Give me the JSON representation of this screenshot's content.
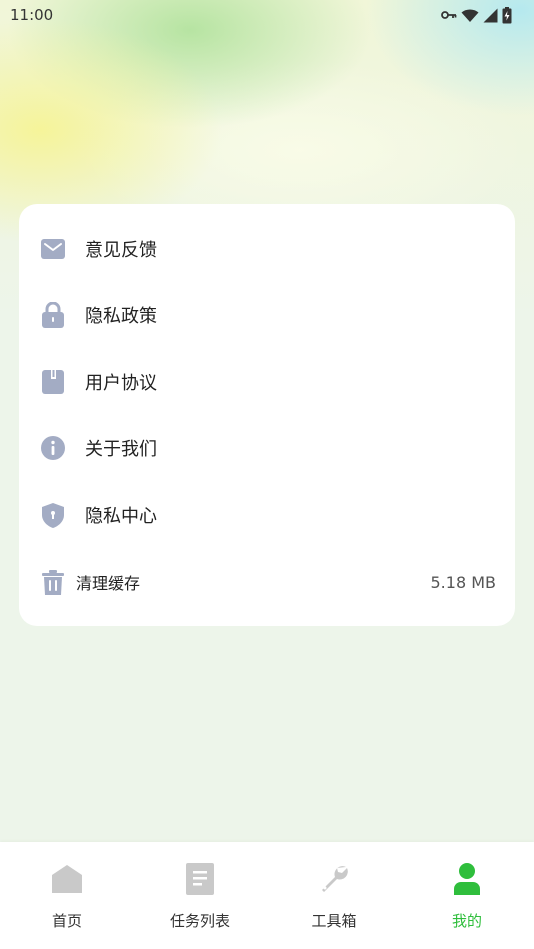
{
  "status_bar": {
    "time": "11:00"
  },
  "menu": {
    "items": [
      {
        "label": "意见反馈",
        "icon": "mail-icon"
      },
      {
        "label": "隐私政策",
        "icon": "lock-icon"
      },
      {
        "label": "用户协议",
        "icon": "book-icon"
      },
      {
        "label": "关于我们",
        "icon": "info-icon"
      },
      {
        "label": "隐私中心",
        "icon": "shield-icon"
      }
    ],
    "cache": {
      "label": "清理缓存",
      "value": "5.18 MB",
      "icon": "trash-icon"
    }
  },
  "tabs": [
    {
      "label": "首页",
      "icon": "home-icon",
      "active": false
    },
    {
      "label": "任务列表",
      "icon": "document-icon",
      "active": false
    },
    {
      "label": "工具箱",
      "icon": "wrench-icon",
      "active": false
    },
    {
      "label": "我的",
      "icon": "person-icon",
      "active": true
    }
  ],
  "colors": {
    "icon_gray": "#a3acc4",
    "active_green": "#2fbe3c",
    "inactive_tab": "#c9c9c9"
  }
}
